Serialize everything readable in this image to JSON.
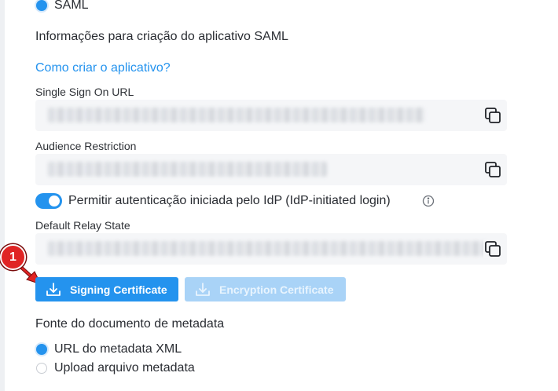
{
  "auth_method": {
    "saml_label": "SAML"
  },
  "saml_info": {
    "title": "Informações para criação do aplicativo SAML",
    "help_link": "Como criar o aplicativo?"
  },
  "fields": {
    "sso_url_label": "Single Sign On URL",
    "audience_label": "Audience Restriction",
    "relay_state_label": "Default Relay State"
  },
  "idp_toggle": {
    "label": "Permitir autenticação iniciada pelo IdP (IdP-initiated login)",
    "enabled": true
  },
  "buttons": {
    "signing": "Signing Certificate",
    "encryption": "Encryption Certificate"
  },
  "callout": {
    "number": "1",
    "color": "#e02424"
  },
  "metadata_source": {
    "title": "Fonte do documento de metadata",
    "options": [
      "URL do metadata XML",
      "Upload arquivo metadata"
    ],
    "selected": "URL do metadata XML"
  },
  "colors": {
    "accent": "#2493ee",
    "accent_disabled": "#a9d3f7",
    "field_bg": "#f5f6f8"
  },
  "icons": [
    "copy-icon",
    "download-icon",
    "info-icon"
  ]
}
